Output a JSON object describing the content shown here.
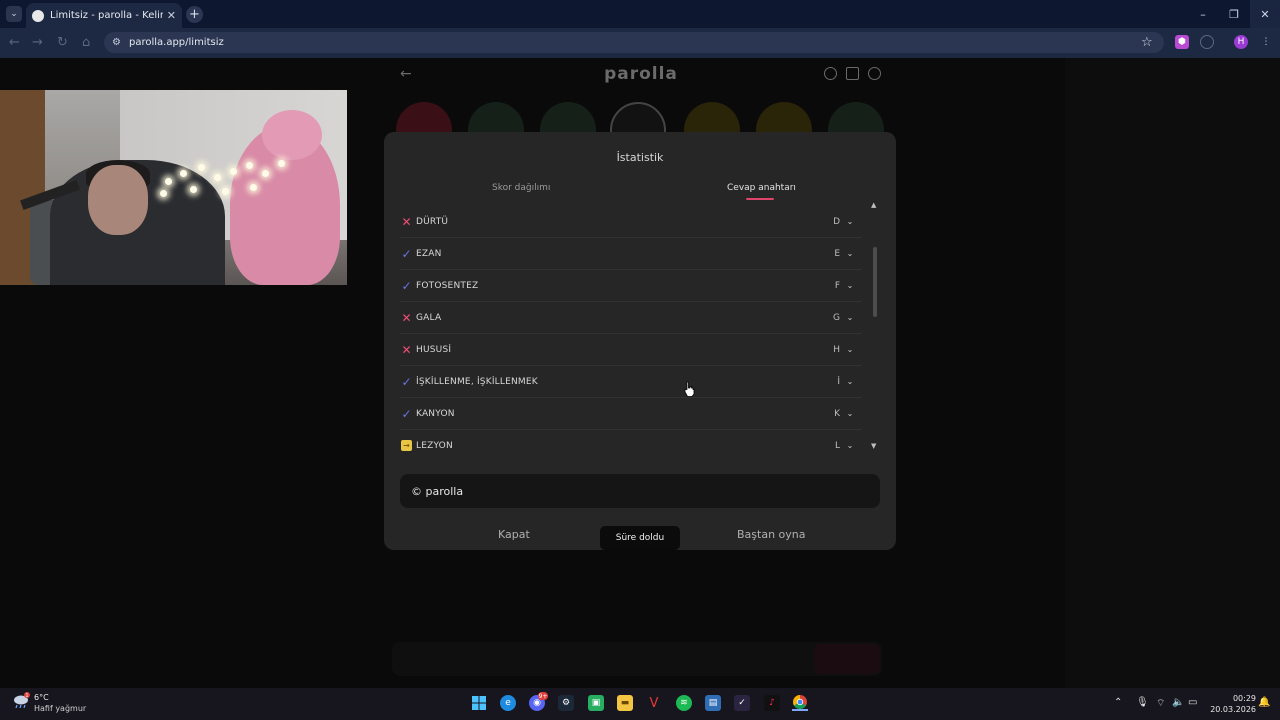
{
  "browser": {
    "tab_title": "Limitsiz - parolla - Kelime oyunu",
    "tab_close": "✕",
    "new_tab": "+",
    "url": "parolla.app/limitsiz",
    "window_controls": [
      "–",
      "❐",
      "✕"
    ]
  },
  "app": {
    "logo": "parolla"
  },
  "modal": {
    "title": "İstatistik",
    "tabs": [
      {
        "label": "Skor dağılımı",
        "active": false
      },
      {
        "label": "Cevap anahtarı",
        "active": true
      }
    ],
    "answers": [
      {
        "word": "DÜRTÜ",
        "letter": "D",
        "status": "wrong"
      },
      {
        "word": "EZAN",
        "letter": "E",
        "status": "right"
      },
      {
        "word": "FOTOSENTEZ",
        "letter": "F",
        "status": "right"
      },
      {
        "word": "GALA",
        "letter": "G",
        "status": "wrong"
      },
      {
        "word": "HUSUSİ",
        "letter": "H",
        "status": "wrong"
      },
      {
        "word": "İŞKİLLENME, İŞKİLLENMEK",
        "letter": "İ",
        "status": "right"
      },
      {
        "word": "KANYON",
        "letter": "K",
        "status": "right"
      },
      {
        "word": "LEZYON",
        "letter": "L",
        "status": "skip"
      }
    ],
    "footer_text": "© parolla",
    "buttons": {
      "close": "Kapat",
      "time_up": "Süre doldu",
      "restart": "Baştan oyna"
    }
  },
  "taskbar": {
    "weather_temp": "6°C",
    "weather_desc": "Hafif yağmur",
    "weather_alert": "1",
    "time": "00:29",
    "date": "20.03.2026",
    "discord_badge": "9+"
  }
}
